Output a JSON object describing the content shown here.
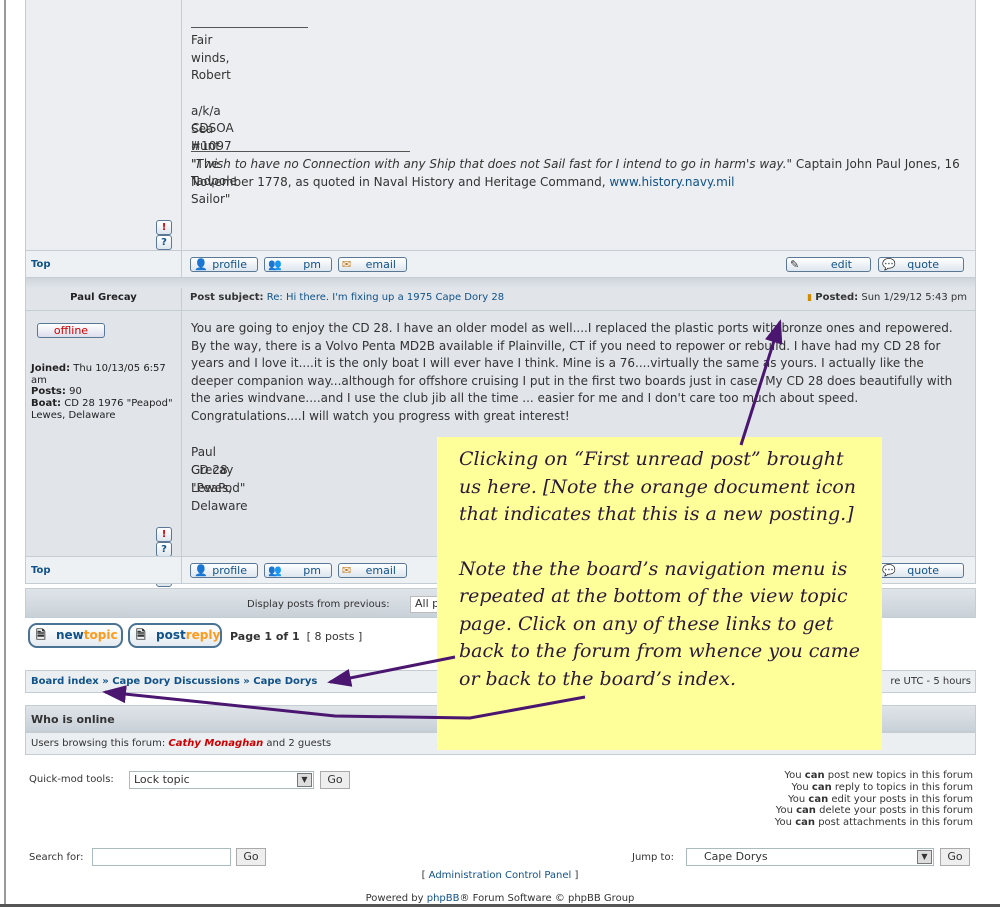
{
  "post1": {
    "lines": [
      "Fair winds,",
      "Robert",
      "a/k/a Sea Hunt \"The Tadpole Sailor\"",
      "CDSOA #1097"
    ],
    "quote_italic": "\"I wish to have no Connection with any Ship that does not Sail fast for I intend to go in harm's way.\"",
    "quote_rest": " Captain John Paul Jones, 16",
    "quote_line2": "November 1778, as quoted in Naval History and Heritage Command, ",
    "quote_link": "www.history.navy.mil"
  },
  "top_label": "Top",
  "buttons": {
    "profile": "profile",
    "pm": "pm",
    "email": "email",
    "edit": "edit",
    "quote": "quote"
  },
  "post2": {
    "author": "Paul Grecay",
    "status": "offline",
    "subject_label": "Post subject:",
    "subject": "Re: Hi there. I'm fixing up a 1975 Cape Dory 28",
    "posted_label": "Posted:",
    "posted": "Sun 1/29/12 5:43 pm",
    "joined_label": "Joined:",
    "joined": "Thu 10/13/05 6:57 am",
    "posts_label": "Posts:",
    "posts": "90",
    "boat_label": "Boat:",
    "boat": "CD 28 1976 \"Peapod\" Lewes, Delaware",
    "body": "You are going to enjoy the CD 28. I have an older model as well....I replaced the plastic ports with bronze ones and repowered. By the way, there is a Volvo Penta MD2B available if Plainville, CT if you need to repower or rebuild. I have had my CD 28 for years and I love it....it is the only boat I will ever have I think. Mine is a 76....virtually the same as yours. I actually like the deeper companion way...although for offshore cruising I put in the first two boards just in case. My CD 28 does beautifully with the aries windvane....and I use the club jib all the time ... easier for me and I don't care too much about speed. Congratulations....I will watch you progress with great interest!",
    "sig": [
      "Paul Grecay",
      "CD 28 \"PeaPod\"",
      "Lewes, Delaware"
    ]
  },
  "display_label": "Display posts from previous:",
  "display_value": "All p",
  "new_topic": {
    "a": "new",
    "b": "topic"
  },
  "post_reply": {
    "a": "post",
    "b": "reply"
  },
  "pagination": {
    "page": "Page 1 of 1",
    "count": "[ 8 posts ]"
  },
  "breadcrumb": [
    "Board index",
    "Cape Dory Discussions",
    "Cape Dorys"
  ],
  "breadcrumb_sep": "»",
  "timezone": "re UTC - 5 hours",
  "who_online": {
    "title": "Who is online",
    "prefix": "Users browsing this forum: ",
    "user": "Cathy Monaghan",
    "suffix": " and 2 guests"
  },
  "quickmod": {
    "label": "Quick-mod tools:",
    "value": "Lock topic",
    "go": "Go"
  },
  "permissions": [
    "post new topics",
    "reply to topics",
    "edit your posts",
    "delete your posts",
    "post attachments"
  ],
  "perm_you": "You ",
  "perm_can": "can",
  "perm_suffix": " in this forum",
  "search": {
    "label": "Search for:",
    "value": "",
    "go": "Go"
  },
  "jump": {
    "label": "Jump to:",
    "value": "Cape Dorys",
    "go": "Go"
  },
  "admin": {
    "open": "[ ",
    "link": "Administration Control Panel",
    "close": " ]"
  },
  "footer": {
    "a": "Powered by ",
    "link": "phpBB",
    "b": "® Forum Software © phpBB Group"
  },
  "callout": {
    "p1": "Clicking on “First unread post” brought us here.  [Note the orange document icon that indicates that this is a new posting.]",
    "p2": "Note the the board’s navigation menu is repeated at the bottom of the view topic page.  Click on any of these links to get back to the forum from whence you came or back to the board’s index."
  },
  "colors": {
    "link": "#105289",
    "callout": "#ffff99",
    "arrow": "#4a1670",
    "online_user": "#cc0000"
  }
}
